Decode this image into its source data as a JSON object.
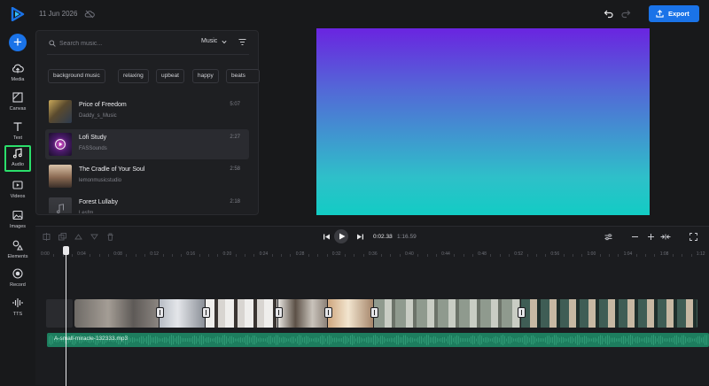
{
  "header": {
    "date": "11 Jun 2026",
    "export_label": "Export"
  },
  "colors": {
    "accent": "#1a73e8",
    "selected_outline": "#2bdf6b",
    "audio_track": "#1d7d5e"
  },
  "sidebar": {
    "items": [
      {
        "label": "Media",
        "icon": "upload-cloud-icon"
      },
      {
        "label": "Canvas",
        "icon": "canvas-icon"
      },
      {
        "label": "Text",
        "icon": "text-icon"
      },
      {
        "label": "Audio",
        "icon": "music-note-icon",
        "selected": true
      },
      {
        "label": "Videos",
        "icon": "video-icon"
      },
      {
        "label": "Images",
        "icon": "image-icon"
      },
      {
        "label": "Elements",
        "icon": "elements-icon"
      },
      {
        "label": "Record",
        "icon": "record-icon"
      },
      {
        "label": "TTS",
        "icon": "tts-icon"
      }
    ]
  },
  "audio_panel": {
    "search_placeholder": "Search music...",
    "category": "Music",
    "chips": [
      "background music",
      "relaxing",
      "upbeat",
      "happy",
      "beats"
    ],
    "tracks": [
      {
        "title": "Price of Freedom",
        "artist": "Daddy_s_Music",
        "duration": "5:07"
      },
      {
        "title": "Lofi Study",
        "artist": "FASSounds",
        "duration": "2:27",
        "selected": true
      },
      {
        "title": "The Cradle of Your Soul",
        "artist": "lemonmusicstudio",
        "duration": "2:58"
      },
      {
        "title": "Forest Lullaby",
        "artist": "Lesfm",
        "duration": "2:18"
      }
    ]
  },
  "timeline": {
    "current_time": "0:02.33",
    "separator": "/",
    "total_time": "1:16.59",
    "ruler": [
      "0:00",
      "0:04",
      "0:08",
      "0:12",
      "0:16",
      "0:20",
      "0:24",
      "0:28",
      "0:32",
      "0:36",
      "0:40",
      "0:44",
      "0:48",
      "0:52",
      "0:56",
      "1:00",
      "1:04",
      "1:08",
      "1:12"
    ],
    "audio_clip_name": "A-small-miracle-132333.mp3"
  }
}
